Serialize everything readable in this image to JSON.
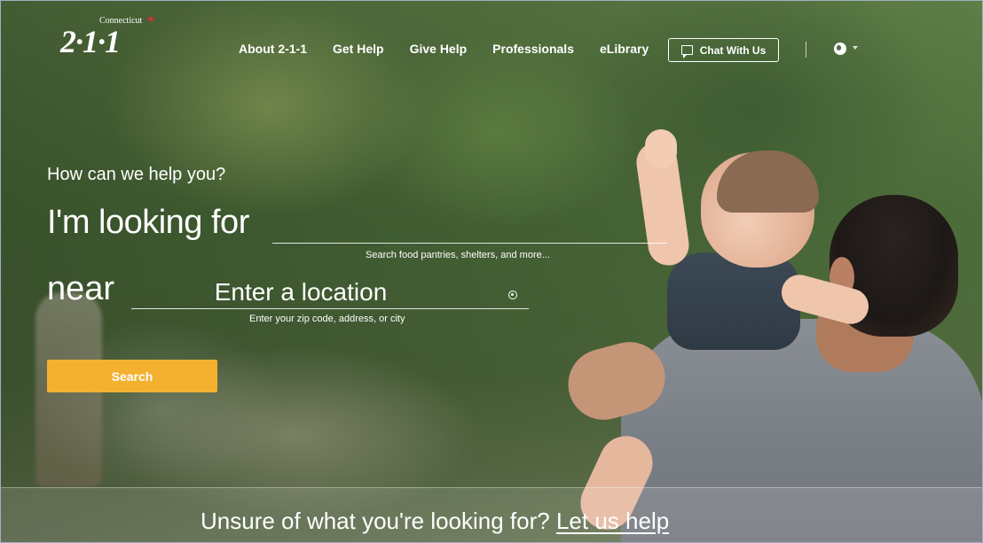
{
  "logo": {
    "state": "Connecticut",
    "number": "2·1·1"
  },
  "nav": {
    "items": [
      "About 2-1-1",
      "Get Help",
      "Give Help",
      "Professionals",
      "eLibrary"
    ],
    "chat_label": "Chat With Us"
  },
  "icons": {
    "chat": "chat-bubble-icon",
    "language": "globe-icon",
    "location": "location-target-icon"
  },
  "search": {
    "heading": "How can we help you?",
    "looking_label": "I'm looking for",
    "looking_value": "",
    "looking_hint": "Search food pantries, shelters, and more...",
    "near_label": "near",
    "near_placeholder": "Enter a location",
    "near_hint": "Enter your zip code, address, or city",
    "button_label": "Search"
  },
  "bottom": {
    "prompt": "Unsure of what you're looking for? ",
    "link": "Let us help"
  },
  "colors": {
    "accent": "#f3b12f",
    "text": "#ffffff"
  }
}
